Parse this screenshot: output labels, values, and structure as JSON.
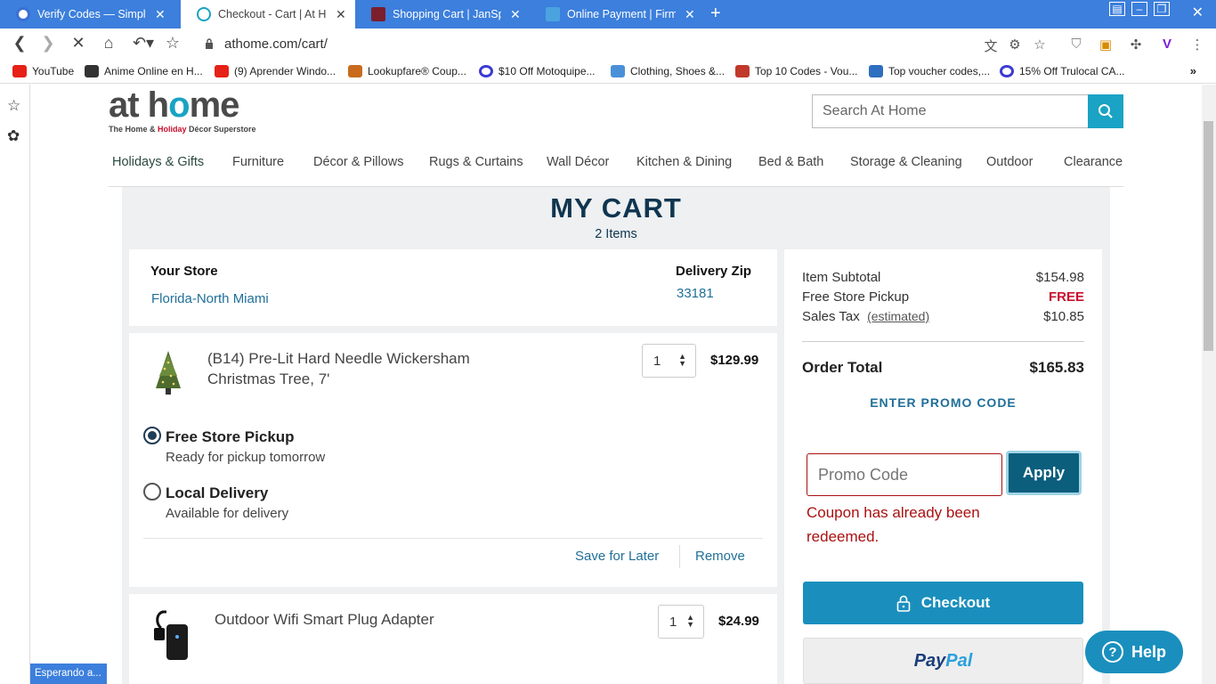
{
  "browser": {
    "tabs": [
      {
        "title": "Verify Codes — SimplyC",
        "color": "#3b6fd4"
      },
      {
        "title": "Checkout - Cart | At Ho",
        "color": "#1aa3c4"
      },
      {
        "title": "Shopping Cart | JanSport",
        "color": "#7a1f2b"
      },
      {
        "title": "Online Payment | Firmoo",
        "color": "#4aa3df"
      }
    ],
    "url": "athome.com/cart/",
    "bookmarks": [
      {
        "label": "YouTube",
        "color": "#e62117"
      },
      {
        "label": "Anime Online en H...",
        "color": "#333333"
      },
      {
        "label": "(9) Aprender Windo...",
        "color": "#e62117"
      },
      {
        "label": "Lookupfare® Coup...",
        "color": "#c86b1e"
      },
      {
        "label": "$10 Off Motoquipe...",
        "color": "#3b3bd4"
      },
      {
        "label": "Clothing, Shoes &...",
        "color": "#4a90d9"
      },
      {
        "label": "Top 10 Codes - Vou...",
        "color": "#c0392b"
      },
      {
        "label": "Top voucher codes,...",
        "color": "#2f6fbf"
      },
      {
        "label": "15% Off Trulocal CA...",
        "color": "#3b3bd4"
      }
    ],
    "status": "Esperando a..."
  },
  "site": {
    "logo_pre": "at h",
    "logo_house": "o",
    "logo_post": "me",
    "tag_pre": "The Home & ",
    "tag_hol": "Holiday",
    "tag_post": " Décor Superstore",
    "search_placeholder": "Search At Home",
    "nav": [
      "Holidays & Gifts",
      "Furniture",
      "Décor & Pillows",
      "Rugs & Curtains",
      "Wall Décor",
      "Kitchen & Dining",
      "Bed & Bath",
      "Storage & Cleaning",
      "Outdoor",
      "Clearance"
    ]
  },
  "cart": {
    "title": "MY CART",
    "count": "2 Items",
    "store_label": "Your Store",
    "store_value": "Florida-North Miami",
    "zip_label": "Delivery Zip",
    "zip_value": "33181",
    "items": [
      {
        "name_line1": "(B14) Pre-Lit Hard Needle Wickersham",
        "name_line2": "Christmas Tree, 7'",
        "qty": "1",
        "price": "$129.99"
      },
      {
        "name_line1": "Outdoor Wifi Smart Plug Adapter",
        "qty": "1",
        "price": "$24.99"
      }
    ],
    "pickup_title": "Free Store Pickup",
    "pickup_sub": "Ready for pickup tomorrow",
    "delivery_title": "Local Delivery",
    "delivery_sub": "Available for delivery",
    "save_later": "Save for Later",
    "remove": "Remove"
  },
  "summary": {
    "subtotal_label": "Item Subtotal",
    "subtotal_value": "$154.98",
    "pickup_label": "Free Store Pickup",
    "pickup_value": "FREE",
    "tax_label": "Sales Tax",
    "tax_note": "(estimated)",
    "tax_value": "$10.85",
    "total_label": "Order Total",
    "total_value": "$165.83",
    "promo_link": "ENTER PROMO CODE",
    "promo_placeholder": "Promo Code",
    "apply": "Apply",
    "error_line1": "Coupon has already been",
    "error_line2": "redeemed.",
    "checkout": "Checkout",
    "paypal_1": "Pay",
    "paypal_2": "Pal",
    "help": "Help"
  }
}
